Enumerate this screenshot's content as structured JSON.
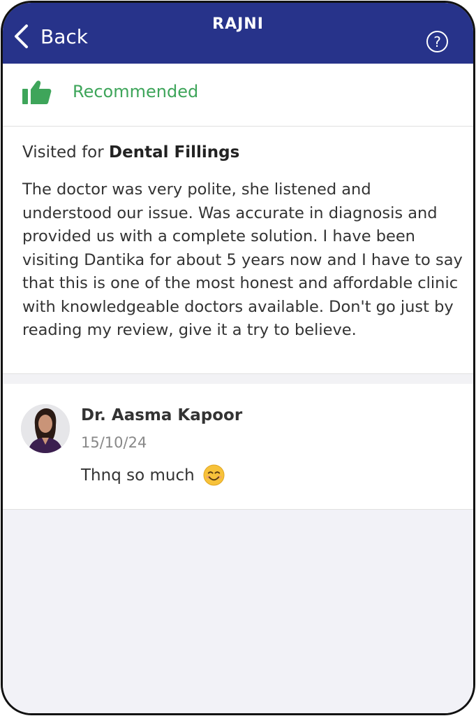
{
  "header": {
    "back_label": "Back",
    "title": "RAJNI",
    "help_symbol": "?",
    "background_color": "#27338a"
  },
  "recommendation": {
    "label": "Recommended",
    "icon": "thumbs-up-icon",
    "color": "#3ea55a"
  },
  "review": {
    "visited_prefix": "Visited for",
    "treatment": "Dental Fillings",
    "body": "The doctor was very polite, she listened and understood our issue. Was accurate in diagnosis and provided us with a complete solution. I have been visiting Dantika for about 5 years now and I have to say that this is one of the most honest and affordable clinic with knowledgeable doctors available. Don't go just by reading my review, give it a try to believe."
  },
  "reply": {
    "doctor_name": "Dr. Aasma Kapoor",
    "date": "15/10/24",
    "text": "Thnq so much",
    "emoji_icon": "smiling-face-emoji-icon"
  }
}
